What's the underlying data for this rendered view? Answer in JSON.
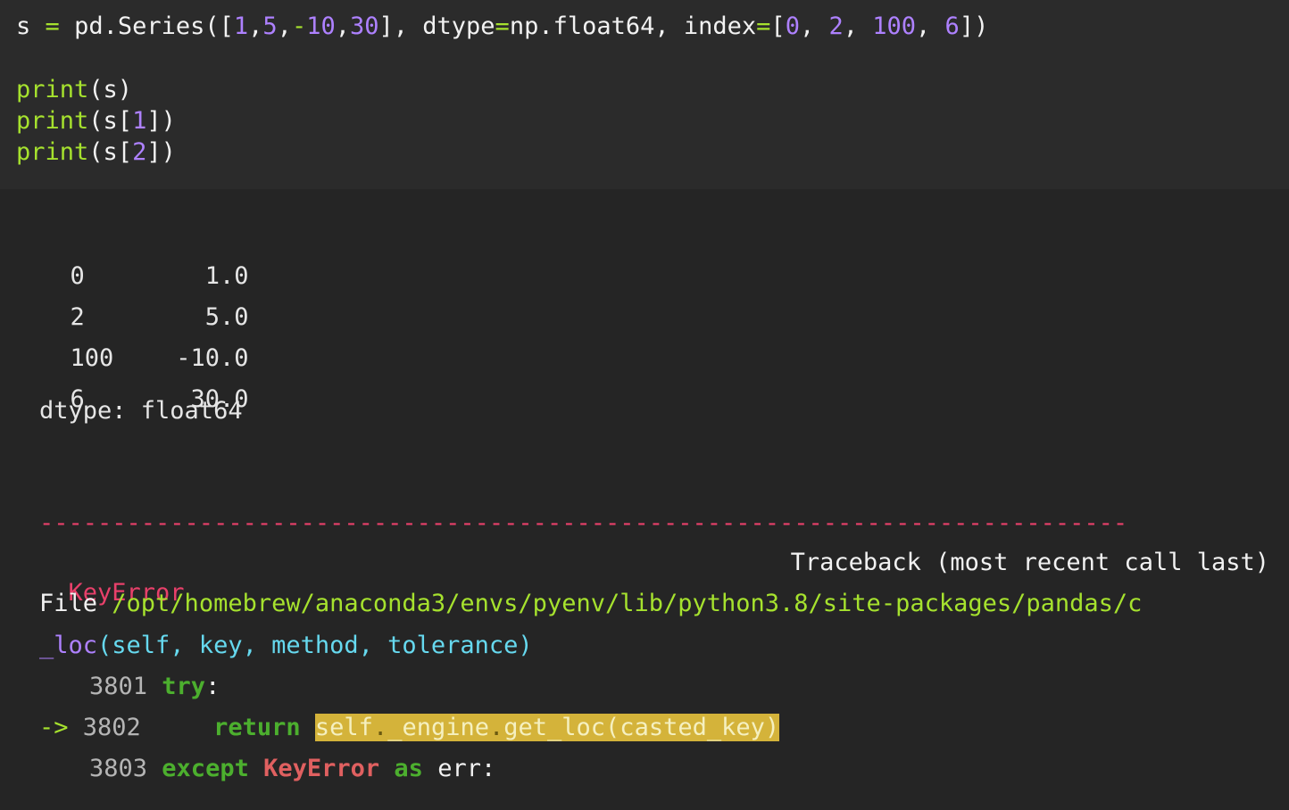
{
  "code": {
    "line1": {
      "var": "s",
      "eq": "=",
      "call": "pd.Series([",
      "n1": "1",
      "c1": ",",
      "n2": "5",
      "c2": ",",
      "minus": "-",
      "n3": "10",
      "c3": ",",
      "n4": "30",
      "mid": "], dtype",
      "eq2": "=",
      "dtype": "np.float64, index",
      "eq3": "=",
      "open": "[",
      "i1": "0",
      "s1": ", ",
      "i2": "2",
      "s2": ", ",
      "i3": "100",
      "s3": ", ",
      "i4": "6",
      "close": "])"
    },
    "line2": {
      "fn": "print",
      "args": "(s)"
    },
    "line3": {
      "fn": "print",
      "pre": "(s[",
      "idx": "1",
      "post": "])"
    },
    "line4": {
      "fn": "print",
      "pre": "(s[",
      "idx": "2",
      "post": "])"
    }
  },
  "output": {
    "rows": [
      {
        "index": "0",
        "value": "1.0"
      },
      {
        "index": "2",
        "value": "5.0"
      },
      {
        "index": "100",
        "value": "-10.0"
      },
      {
        "index": "6",
        "value": "30.0"
      }
    ],
    "dtype_label": "dtype: float64"
  },
  "traceback": {
    "separator": "---------------------------------------------------------------------------",
    "error_name": "KeyError",
    "traceback_header": "Traceback (most recent call last)",
    "file_label": "File ",
    "file_path": "/opt/homebrew/anaconda3/envs/pyenv/lib/python3.8/site-packages/pandas/c",
    "func_name": "_loc",
    "func_args": "(self, key, method, tolerance)",
    "lines": {
      "l3801_num": "3801",
      "l3801_kw": "try",
      "l3801_rest": ":",
      "l3802_arrow": "->",
      "l3802_num": "3802",
      "l3802_kw": "return",
      "l3802_hl_a": "self",
      "l3802_hl_b": ".",
      "l3802_hl_c": "_engine",
      "l3802_hl_d": ".",
      "l3802_hl_e": "get_loc(casted_key)",
      "l3803_num": "3803",
      "l3803_kw": "except",
      "l3803_err": "KeyError",
      "l3803_as": "as",
      "l3803_rest": "err:"
    }
  },
  "colors": {
    "background": "#252525",
    "code_background": "#2b2b2b",
    "keyword": "#a6e22e",
    "number": "#ae81ff",
    "error": "#e8406a",
    "highlight": "#d4b33a"
  }
}
